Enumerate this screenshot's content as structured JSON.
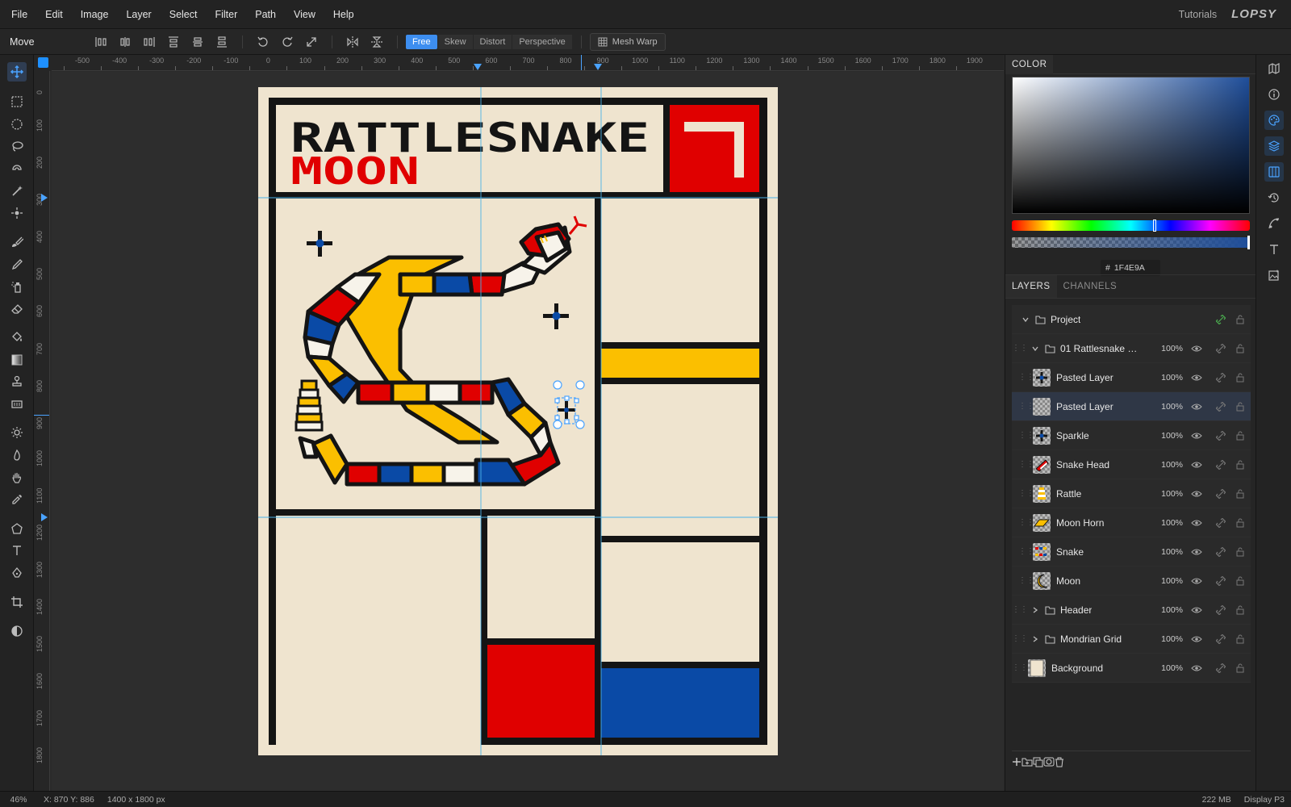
{
  "menu": {
    "items": [
      "File",
      "Edit",
      "Image",
      "Layer",
      "Select",
      "Filter",
      "Path",
      "View",
      "Help"
    ],
    "tutorials": "Tutorials",
    "logo": "LOPSY"
  },
  "toolbar": {
    "tool_name": "Move",
    "modes": [
      "Free",
      "Skew",
      "Distort",
      "Perspective"
    ],
    "active_mode": "Free",
    "mesh_warp": "Mesh Warp"
  },
  "tools": [
    "move-icon",
    "rect-select-icon",
    "ellipse-select-icon",
    "lasso-icon",
    "magnetic-lasso-icon",
    "magic-wand-icon",
    "quick-select-icon",
    "brush-icon",
    "pencil-icon",
    "spray-icon",
    "eraser-icon",
    "bucket-icon",
    "gradient-icon",
    "stamp-icon",
    "pattern-icon",
    "dodge-icon",
    "burn-icon",
    "hand-icon",
    "eyedropper-icon",
    "polygon-icon",
    "text-icon",
    "pen-icon",
    "crop-icon",
    "contrast-icon"
  ],
  "ruler": {
    "h_labels": [
      "-500",
      "-400",
      "-300",
      "-200",
      "-100",
      "0",
      "100",
      "200",
      "300",
      "400",
      "500",
      "600",
      "700",
      "800",
      "900",
      "1000",
      "1100",
      "1200",
      "1300",
      "1400",
      "1500",
      "1600",
      "1700",
      "1800",
      "1900"
    ],
    "v_labels": [
      "0",
      "100",
      "200",
      "300",
      "400",
      "500",
      "600",
      "700",
      "800",
      "900",
      "1000",
      "1100",
      "1200",
      "1300",
      "1400",
      "1500",
      "1600",
      "1700",
      "1800"
    ]
  },
  "poster": {
    "title_line1": "RATTLESNAKE",
    "title_line2": "MOON",
    "colors": {
      "cream": "#efe4cf",
      "black": "#141414",
      "red": "#e00000",
      "yellow": "#fbbf00",
      "blue": "#0a4aa6",
      "white": "#f7f3ea"
    }
  },
  "color_panel": {
    "tab": "COLOR",
    "hex_label": "#",
    "hex": "1F4E9A",
    "color": "#1f4e9a"
  },
  "layers_panel": {
    "tabs": [
      "LAYERS",
      "CHANNELS"
    ],
    "layers": [
      {
        "name": "Project",
        "type": "group",
        "indent": 0,
        "opacity": "",
        "icon": "folder-icon",
        "selected": false
      },
      {
        "name": "01 Rattlesnake M...",
        "type": "group",
        "indent": 1,
        "opacity": "100%",
        "icon": "folder-icon",
        "selected": false
      },
      {
        "name": "Pasted Layer",
        "type": "layer",
        "indent": 2,
        "opacity": "100%",
        "icon": "sparkle-thumb",
        "selected": false
      },
      {
        "name": "Pasted Layer",
        "type": "layer",
        "indent": 2,
        "opacity": "100%",
        "icon": "empty-thumb",
        "selected": true
      },
      {
        "name": "Sparkle",
        "type": "layer",
        "indent": 2,
        "opacity": "100%",
        "icon": "sparkle-thumb",
        "selected": false
      },
      {
        "name": "Snake Head",
        "type": "layer",
        "indent": 2,
        "opacity": "100%",
        "icon": "snake-head-thumb",
        "selected": false
      },
      {
        "name": "Rattle",
        "type": "layer",
        "indent": 2,
        "opacity": "100%",
        "icon": "rattle-thumb",
        "selected": false
      },
      {
        "name": "Moon Horn",
        "type": "layer",
        "indent": 2,
        "opacity": "100%",
        "icon": "moon-horn-thumb",
        "selected": false
      },
      {
        "name": "Snake",
        "type": "layer",
        "indent": 2,
        "opacity": "100%",
        "icon": "snake-thumb",
        "selected": false
      },
      {
        "name": "Moon",
        "type": "layer",
        "indent": 2,
        "opacity": "100%",
        "icon": "moon-thumb",
        "selected": false
      },
      {
        "name": "Header",
        "type": "group",
        "indent": 1,
        "opacity": "100%",
        "icon": "folder-icon",
        "selected": false
      },
      {
        "name": "Mondrian Grid",
        "type": "group",
        "indent": 1,
        "opacity": "100%",
        "icon": "folder-icon",
        "selected": false
      },
      {
        "name": "Background",
        "type": "layer",
        "indent": 0,
        "opacity": "100%",
        "icon": "background-thumb",
        "selected": false
      }
    ]
  },
  "status": {
    "zoom": "46%",
    "coords": "X: 870  Y: 886",
    "doc_size": "1400 x 1800 px",
    "memory": "222 MB",
    "display": "Display P3"
  }
}
